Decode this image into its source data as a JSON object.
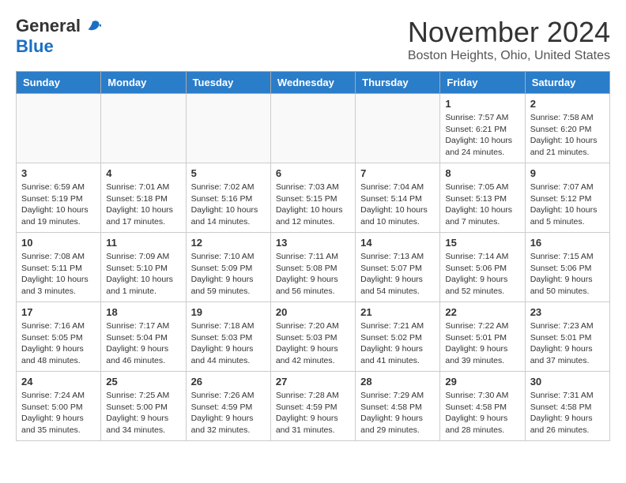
{
  "header": {
    "logo_general": "General",
    "logo_blue": "Blue",
    "month_title": "November 2024",
    "location": "Boston Heights, Ohio, United States"
  },
  "weekdays": [
    "Sunday",
    "Monday",
    "Tuesday",
    "Wednesday",
    "Thursday",
    "Friday",
    "Saturday"
  ],
  "weeks": [
    [
      {
        "day": "",
        "info": ""
      },
      {
        "day": "",
        "info": ""
      },
      {
        "day": "",
        "info": ""
      },
      {
        "day": "",
        "info": ""
      },
      {
        "day": "",
        "info": ""
      },
      {
        "day": "1",
        "info": "Sunrise: 7:57 AM\nSunset: 6:21 PM\nDaylight: 10 hours\nand 24 minutes."
      },
      {
        "day": "2",
        "info": "Sunrise: 7:58 AM\nSunset: 6:20 PM\nDaylight: 10 hours\nand 21 minutes."
      }
    ],
    [
      {
        "day": "3",
        "info": "Sunrise: 6:59 AM\nSunset: 5:19 PM\nDaylight: 10 hours\nand 19 minutes."
      },
      {
        "day": "4",
        "info": "Sunrise: 7:01 AM\nSunset: 5:18 PM\nDaylight: 10 hours\nand 17 minutes."
      },
      {
        "day": "5",
        "info": "Sunrise: 7:02 AM\nSunset: 5:16 PM\nDaylight: 10 hours\nand 14 minutes."
      },
      {
        "day": "6",
        "info": "Sunrise: 7:03 AM\nSunset: 5:15 PM\nDaylight: 10 hours\nand 12 minutes."
      },
      {
        "day": "7",
        "info": "Sunrise: 7:04 AM\nSunset: 5:14 PM\nDaylight: 10 hours\nand 10 minutes."
      },
      {
        "day": "8",
        "info": "Sunrise: 7:05 AM\nSunset: 5:13 PM\nDaylight: 10 hours\nand 7 minutes."
      },
      {
        "day": "9",
        "info": "Sunrise: 7:07 AM\nSunset: 5:12 PM\nDaylight: 10 hours\nand 5 minutes."
      }
    ],
    [
      {
        "day": "10",
        "info": "Sunrise: 7:08 AM\nSunset: 5:11 PM\nDaylight: 10 hours\nand 3 minutes."
      },
      {
        "day": "11",
        "info": "Sunrise: 7:09 AM\nSunset: 5:10 PM\nDaylight: 10 hours\nand 1 minute."
      },
      {
        "day": "12",
        "info": "Sunrise: 7:10 AM\nSunset: 5:09 PM\nDaylight: 9 hours\nand 59 minutes."
      },
      {
        "day": "13",
        "info": "Sunrise: 7:11 AM\nSunset: 5:08 PM\nDaylight: 9 hours\nand 56 minutes."
      },
      {
        "day": "14",
        "info": "Sunrise: 7:13 AM\nSunset: 5:07 PM\nDaylight: 9 hours\nand 54 minutes."
      },
      {
        "day": "15",
        "info": "Sunrise: 7:14 AM\nSunset: 5:06 PM\nDaylight: 9 hours\nand 52 minutes."
      },
      {
        "day": "16",
        "info": "Sunrise: 7:15 AM\nSunset: 5:06 PM\nDaylight: 9 hours\nand 50 minutes."
      }
    ],
    [
      {
        "day": "17",
        "info": "Sunrise: 7:16 AM\nSunset: 5:05 PM\nDaylight: 9 hours\nand 48 minutes."
      },
      {
        "day": "18",
        "info": "Sunrise: 7:17 AM\nSunset: 5:04 PM\nDaylight: 9 hours\nand 46 minutes."
      },
      {
        "day": "19",
        "info": "Sunrise: 7:18 AM\nSunset: 5:03 PM\nDaylight: 9 hours\nand 44 minutes."
      },
      {
        "day": "20",
        "info": "Sunrise: 7:20 AM\nSunset: 5:03 PM\nDaylight: 9 hours\nand 42 minutes."
      },
      {
        "day": "21",
        "info": "Sunrise: 7:21 AM\nSunset: 5:02 PM\nDaylight: 9 hours\nand 41 minutes."
      },
      {
        "day": "22",
        "info": "Sunrise: 7:22 AM\nSunset: 5:01 PM\nDaylight: 9 hours\nand 39 minutes."
      },
      {
        "day": "23",
        "info": "Sunrise: 7:23 AM\nSunset: 5:01 PM\nDaylight: 9 hours\nand 37 minutes."
      }
    ],
    [
      {
        "day": "24",
        "info": "Sunrise: 7:24 AM\nSunset: 5:00 PM\nDaylight: 9 hours\nand 35 minutes."
      },
      {
        "day": "25",
        "info": "Sunrise: 7:25 AM\nSunset: 5:00 PM\nDaylight: 9 hours\nand 34 minutes."
      },
      {
        "day": "26",
        "info": "Sunrise: 7:26 AM\nSunset: 4:59 PM\nDaylight: 9 hours\nand 32 minutes."
      },
      {
        "day": "27",
        "info": "Sunrise: 7:28 AM\nSunset: 4:59 PM\nDaylight: 9 hours\nand 31 minutes."
      },
      {
        "day": "28",
        "info": "Sunrise: 7:29 AM\nSunset: 4:58 PM\nDaylight: 9 hours\nand 29 minutes."
      },
      {
        "day": "29",
        "info": "Sunrise: 7:30 AM\nSunset: 4:58 PM\nDaylight: 9 hours\nand 28 minutes."
      },
      {
        "day": "30",
        "info": "Sunrise: 7:31 AM\nSunset: 4:58 PM\nDaylight: 9 hours\nand 26 minutes."
      }
    ]
  ]
}
